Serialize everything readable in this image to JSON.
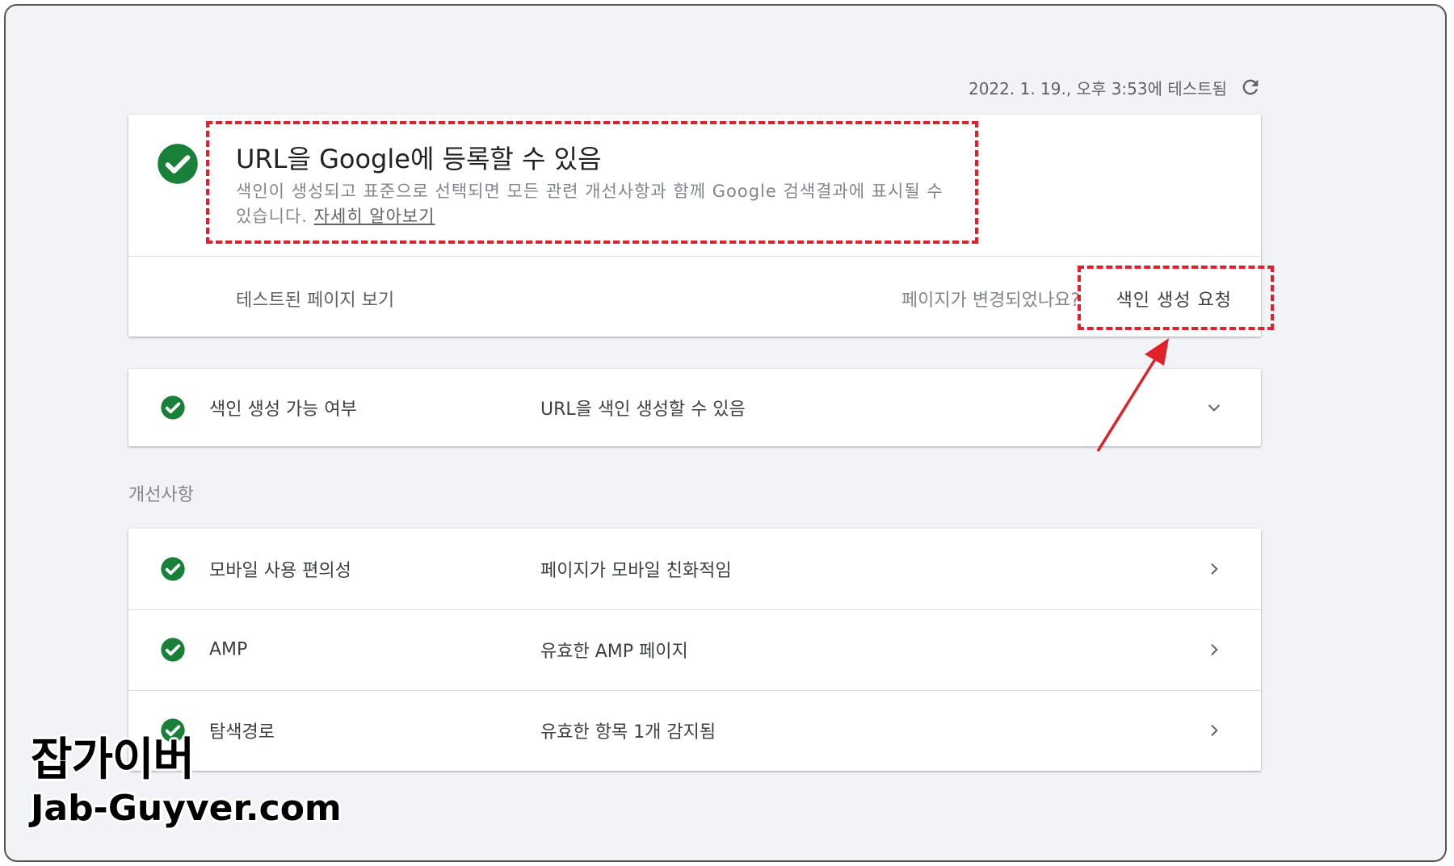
{
  "tested_at": "2022. 1. 19., 오후 3:53에 테스트됨",
  "main_card": {
    "title": "URL을 Google에 등록할 수 있음",
    "description": "색인이 생성되고 표준으로 선택되면 모든 관련 개선사항과 함께 Google 검색결과에 표시될 수 있습니다.",
    "learn_more": "자세히 알아보기",
    "view_tested_page": "테스트된 페이지 보기",
    "page_changed_question": "페이지가 변경되었나요?",
    "request_indexing": "색인 생성 요청"
  },
  "coverage": {
    "name": "색인 생성 가능 여부",
    "value": "URL을 색인 생성할 수 있음"
  },
  "enhancements_label": "개선사항",
  "enhancements": [
    {
      "name": "모바일 사용 편의성",
      "value": "페이지가 모바일 친화적임"
    },
    {
      "name": "AMP",
      "value": "유효한 AMP 페이지"
    },
    {
      "name": "탐색경로",
      "value": "유효한 항목 1개 감지됨"
    }
  ],
  "watermark": {
    "korean": "잡가이버",
    "english": "Jab-Guyver.com"
  },
  "colors": {
    "success_green": "#188038",
    "annotation_red": "#e0202a",
    "background": "#f1f3f7"
  },
  "icons": {
    "status": "check-circle-icon",
    "refresh": "refresh-icon",
    "expand": "chevron-down-icon",
    "navigate": "chevron-right-icon"
  }
}
